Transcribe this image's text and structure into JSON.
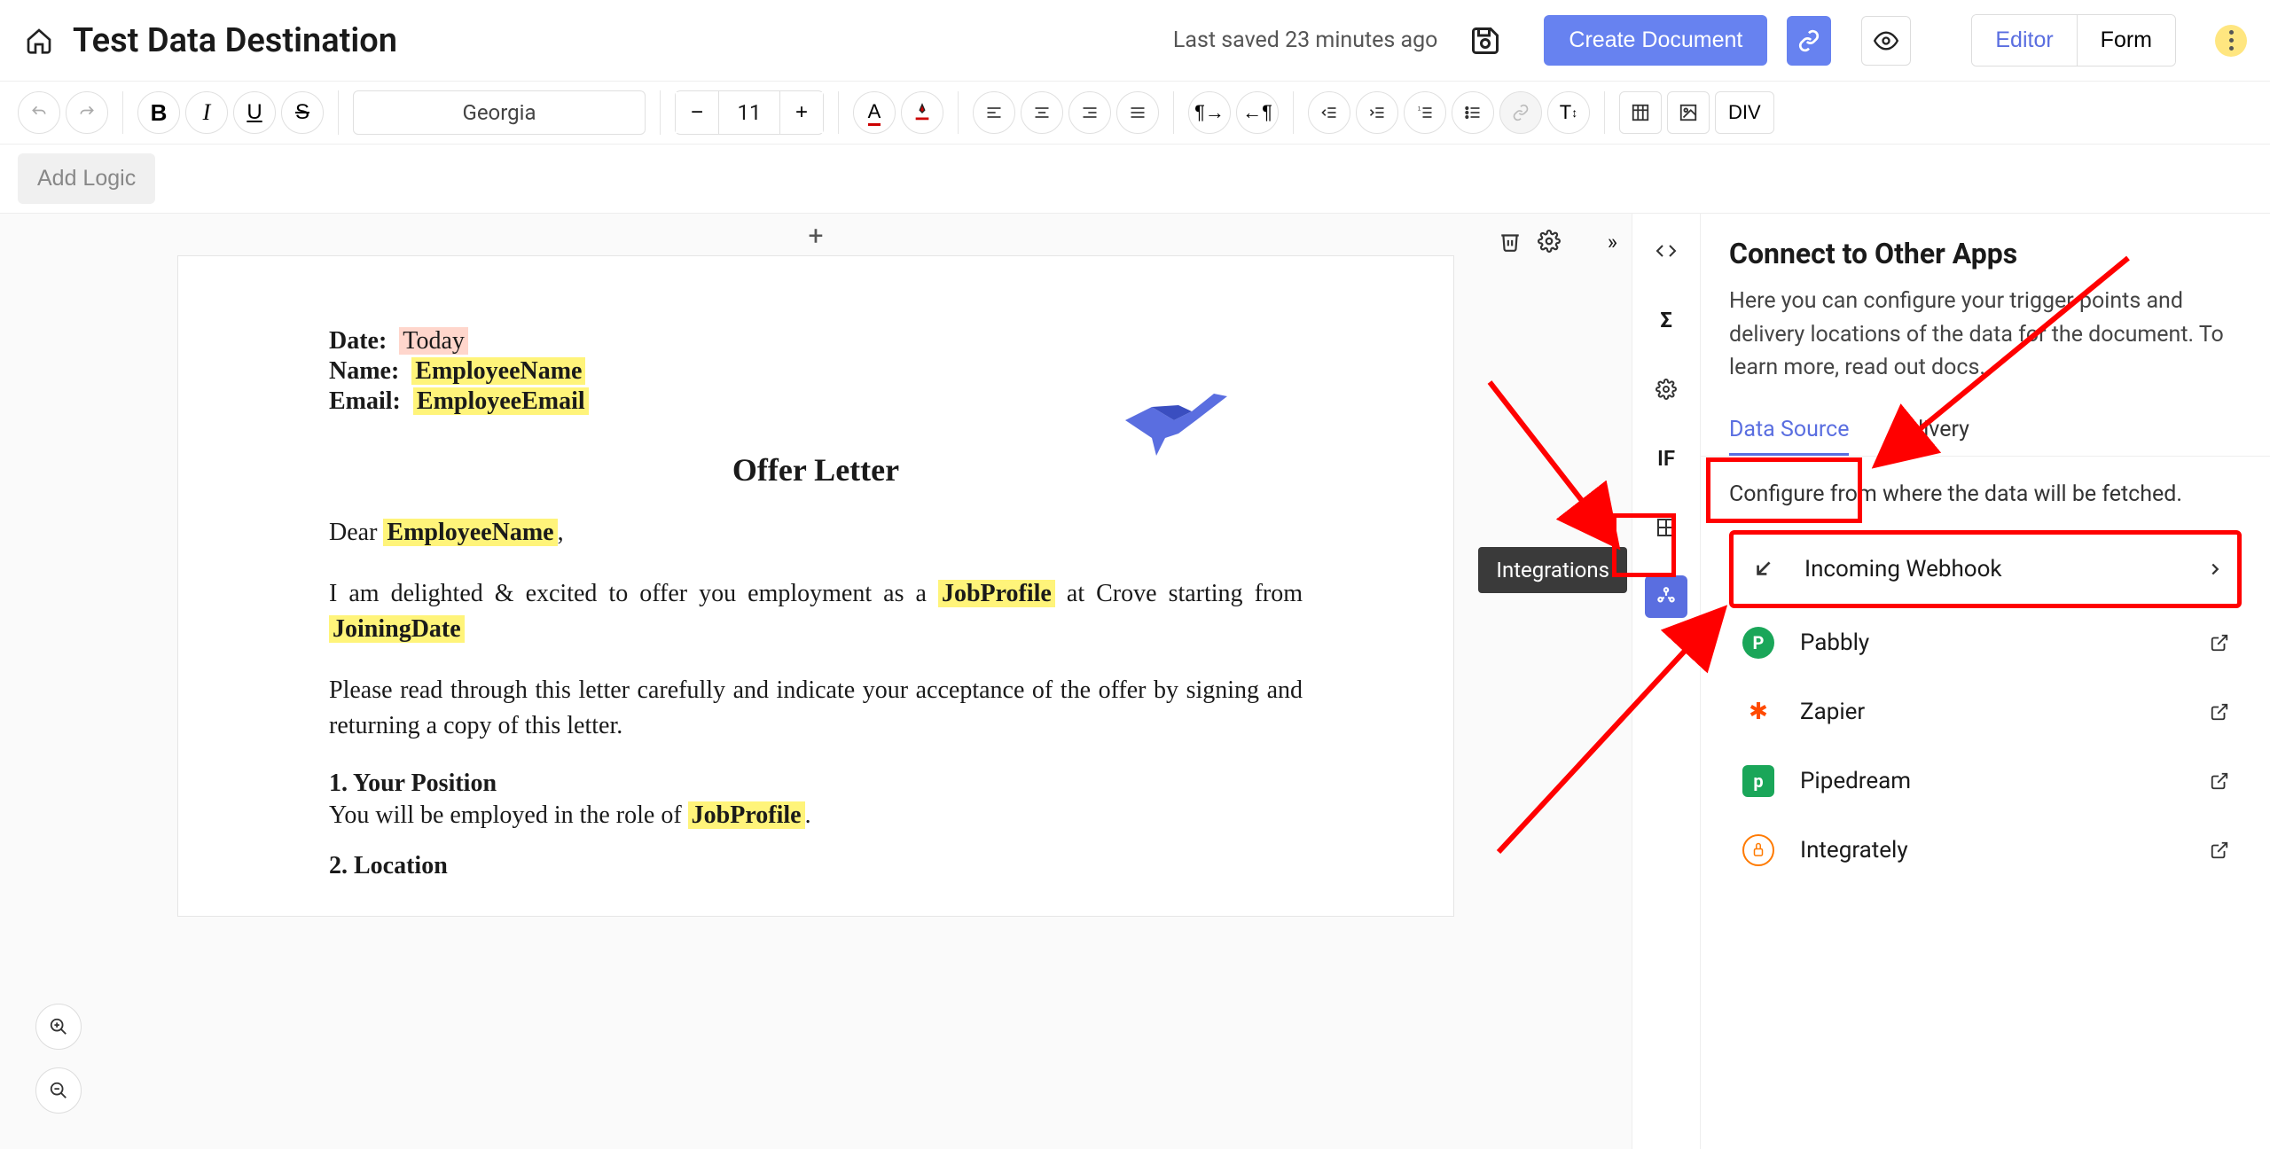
{
  "header": {
    "title": "Test Data Destination",
    "saved": "Last saved 23 minutes ago",
    "create": "Create Document",
    "seg": {
      "editor": "Editor",
      "form": "Form"
    }
  },
  "toolbar": {
    "font": "Georgia",
    "size": "11",
    "div": "DIV",
    "b": "B",
    "i": "I",
    "u": "U",
    "s": "S",
    "if": "IF",
    "sigma": "Σ",
    "tcap": "T"
  },
  "logic": {
    "add": "Add Logic"
  },
  "doc": {
    "date_l": "Date:",
    "date_v": "Today",
    "name_l": "Name:",
    "name_v": "EmployeeName",
    "email_l": "Email:",
    "email_v": "EmployeeEmail",
    "title": "Offer Letter",
    "dear": "Dear ",
    "dear_v": "EmployeeName",
    "p1a": "I am delighted & excited to offer you employment as a ",
    "p1_job": "JobProfile",
    "p1b": " at Crove starting from ",
    "p1_join": "JoiningDate",
    "p2": "Please read through this letter carefully and indicate your acceptance of the offer by signing and returning a copy of this letter.",
    "h1": "1. Your Position",
    "p3a": "You will be employed in the role of ",
    "p3_job": "JobProfile",
    "p3b": ".",
    "h2": "2. Location"
  },
  "rail": {
    "tooltip": "Integrations"
  },
  "panel": {
    "title": "Connect to Other Apps",
    "desc": "Here you can configure your trigger points and delivery locations of the data for the document. To learn more, read out docs.",
    "tabs": {
      "ds": "Data Source",
      "del": "Delivery"
    },
    "cfg": "Configure from where the data will be fetched.",
    "sources": {
      "webhook": "Incoming Webhook",
      "pabbly": "Pabbly",
      "zapier": "Zapier",
      "pipedream": "Pipedream",
      "integrately": "Integrately"
    }
  }
}
